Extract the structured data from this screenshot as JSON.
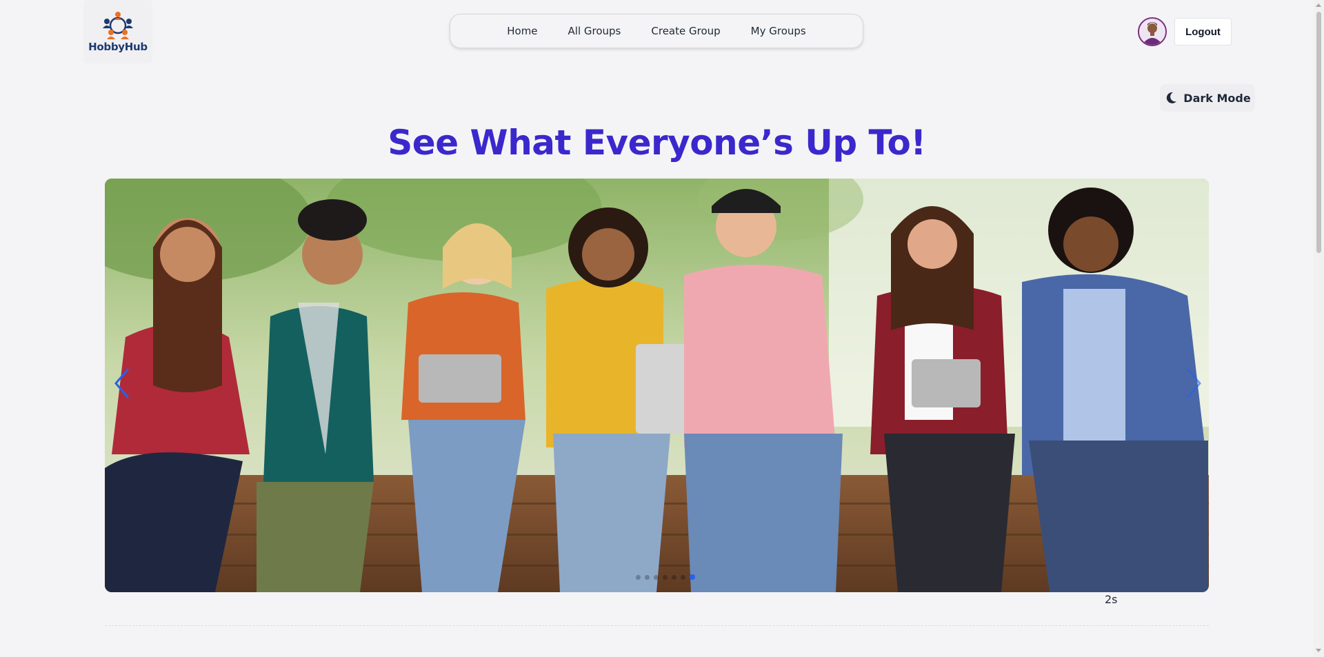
{
  "header": {
    "logo_text": "HobbyHub",
    "logout_label": "Logout",
    "nav": [
      {
        "label": "Home"
      },
      {
        "label": "All Groups"
      },
      {
        "label": "Create Group"
      },
      {
        "label": "My Groups"
      }
    ]
  },
  "theme_toggle": {
    "label": "Dark Mode",
    "icon": "moon-icon"
  },
  "hero": {
    "title": "See What Everyone’s Up To!",
    "slider": {
      "total_slides": 7,
      "active_index": 6,
      "timer_text": "2s"
    }
  },
  "colors": {
    "title": "#3b28cc",
    "accent": "#2563eb",
    "background": "#f4f4f6"
  }
}
